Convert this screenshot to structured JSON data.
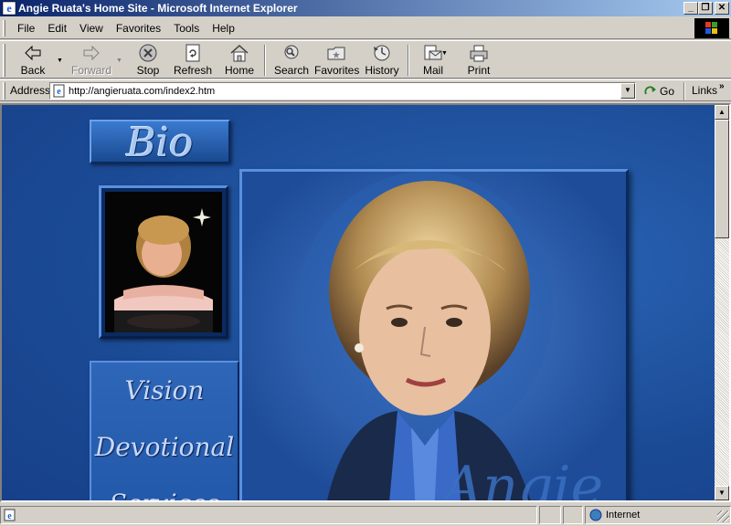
{
  "window": {
    "title": "Angie Ruata's Home Site - Microsoft Internet Explorer",
    "controls": {
      "minimize": "_",
      "restore": "❐",
      "close": "✕"
    }
  },
  "menu": {
    "items": [
      {
        "label": "File",
        "key": "F"
      },
      {
        "label": "Edit",
        "key": "E"
      },
      {
        "label": "View",
        "key": "V"
      },
      {
        "label": "Favorites",
        "key": "a"
      },
      {
        "label": "Tools",
        "key": "T"
      },
      {
        "label": "Help",
        "key": "H"
      }
    ]
  },
  "toolbar": {
    "back": "Back",
    "forward": "Forward",
    "stop": "Stop",
    "refresh": "Refresh",
    "home": "Home",
    "search": "Search",
    "favorites": "Favorites",
    "history": "History",
    "mail": "Mail",
    "print": "Print"
  },
  "address": {
    "label": "Address",
    "url": "http://angieruata.com/index2.htm",
    "go_label": "Go",
    "links_label": "Links",
    "links_chevron": "»"
  },
  "page": {
    "bio_heading": "Bio",
    "nav": [
      "Vision",
      "Devotional",
      "Services"
    ],
    "signature": "Angie"
  },
  "status": {
    "text": "",
    "zone": "Internet"
  },
  "colors": {
    "page_background": "#1d4f9a",
    "titlebar_start": "#0a246a",
    "titlebar_end": "#a6caf0",
    "chrome": "#d4d0c8"
  },
  "icons": {
    "browser": "ie-logo-icon",
    "zone": "globe-icon"
  }
}
